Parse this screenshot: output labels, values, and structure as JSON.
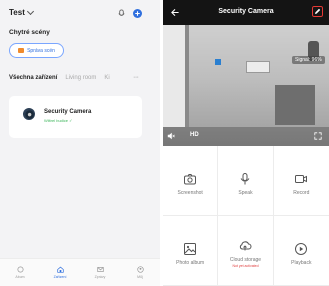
{
  "left": {
    "home_name": "Test",
    "scenes_title": "Chytré scény",
    "scene_button": "Správa scén",
    "tabs": [
      "Všechna zařízení",
      "Living room",
      "Ki"
    ],
    "more": "···",
    "device": {
      "name": "Security Camera",
      "status": "Wiltrel budice ✓",
      "icon": "camera-device-icon"
    },
    "nav": [
      {
        "label": "Abum",
        "icon": "circle-icon"
      },
      {
        "label": "Zařízení",
        "icon": "home-icon"
      },
      {
        "label": "Zprávy",
        "icon": "message-icon"
      },
      {
        "label": "Můj",
        "icon": "profile-icon"
      }
    ]
  },
  "right": {
    "title": "Security Camera",
    "signal": "Signal: 96%",
    "hd": "HD",
    "controls": [
      {
        "label": "Screenshot",
        "sub": "",
        "icon": "camera-icon"
      },
      {
        "label": "Speak",
        "sub": "",
        "icon": "microphone-icon"
      },
      {
        "label": "Record",
        "sub": "",
        "icon": "video-icon"
      },
      {
        "label": "Photo album",
        "sub": "",
        "icon": "image-icon"
      },
      {
        "label": "Cloud storage",
        "sub": "Not yet activated",
        "icon": "cloud-icon"
      },
      {
        "label": "Playback",
        "sub": "",
        "icon": "play-icon"
      }
    ]
  },
  "colors": {
    "accent": "#2f6fde",
    "topbar": "#141414",
    "online": "#3cb55a",
    "edit_highlight": "#e53935"
  }
}
